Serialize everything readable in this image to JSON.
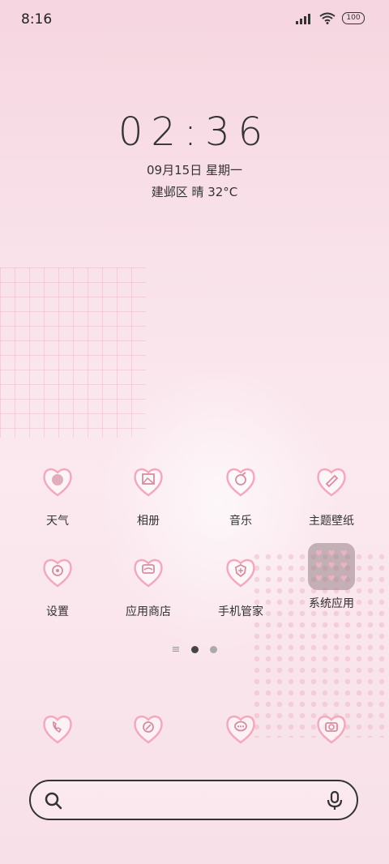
{
  "status_bar": {
    "time": "8:16",
    "battery": "100"
  },
  "lockclock": {
    "time": "02:36",
    "date": "09月15日 星期一",
    "weather": "建邺区 晴 32°C"
  },
  "apps_row1": [
    {
      "label": "天气",
      "icon": "weather-icon"
    },
    {
      "label": "相册",
      "icon": "gallery-icon"
    },
    {
      "label": "音乐",
      "icon": "music-icon"
    },
    {
      "label": "主题壁纸",
      "icon": "themes-icon"
    }
  ],
  "apps_row2": [
    {
      "label": "设置",
      "icon": "settings-icon"
    },
    {
      "label": "应用商店",
      "icon": "app-store-icon"
    },
    {
      "label": "手机管家",
      "icon": "security-icon"
    },
    {
      "label": "系统应用",
      "icon": "folder-icon"
    }
  ],
  "dock": [
    {
      "icon": "phone-icon"
    },
    {
      "icon": "browser-icon"
    },
    {
      "icon": "messages-icon"
    },
    {
      "icon": "camera-icon"
    }
  ],
  "page_indicator": {
    "pages": 2,
    "active": 1
  },
  "colors": {
    "accent_pink": "#f3a9bd",
    "text": "#333333"
  }
}
